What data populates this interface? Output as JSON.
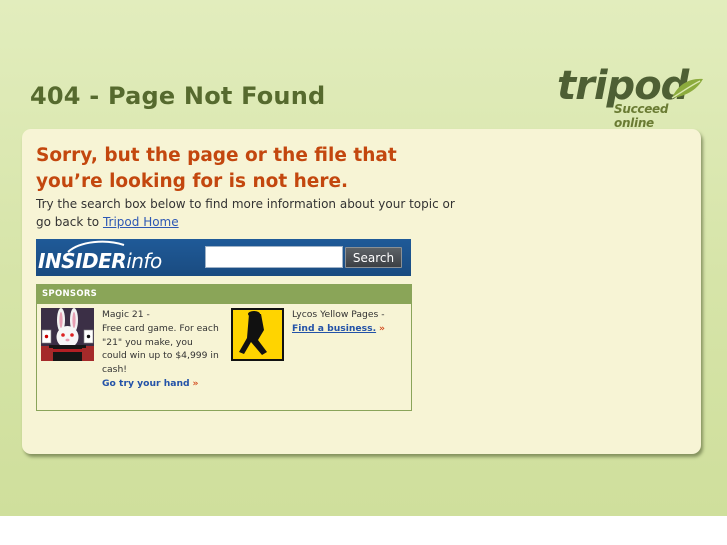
{
  "header": {
    "title": "404 - Page Not Found",
    "logo_text": "tripod",
    "logo_tagline": "Succeed online"
  },
  "message": {
    "heading": "Sorry, but the page or the file that you’re looking for is not here.",
    "body_before_link": "Try the search box below to find more information about your topic or go back to ",
    "link_label": "Tripod Home"
  },
  "search": {
    "brand_bold": "INSIDER",
    "brand_light": "info",
    "input_value": "",
    "button_label": "Search"
  },
  "sponsors": {
    "header": "SPONSORS",
    "items": [
      {
        "thumb_icon": "magic-bunny-hat-icon",
        "title": "Magic 21 -",
        "description": "Free card game. For each \"21\" you make, you could win up to $4,999 in cash!",
        "link_label": "Go try your hand",
        "arrow": "»"
      },
      {
        "thumb_icon": "yellow-pages-walking-fingers-icon",
        "title": "Lycos Yellow Pages -",
        "description": "",
        "link_label": "Find a business.",
        "arrow": "»"
      }
    ]
  },
  "colors": {
    "background": "#d6e4a8",
    "card": "#f7f4d5",
    "title": "#566a2e",
    "heading": "#c3470e",
    "link": "#2d58b4",
    "insider_bar": "#1f5a98",
    "sponsors_header": "#8aa558"
  }
}
